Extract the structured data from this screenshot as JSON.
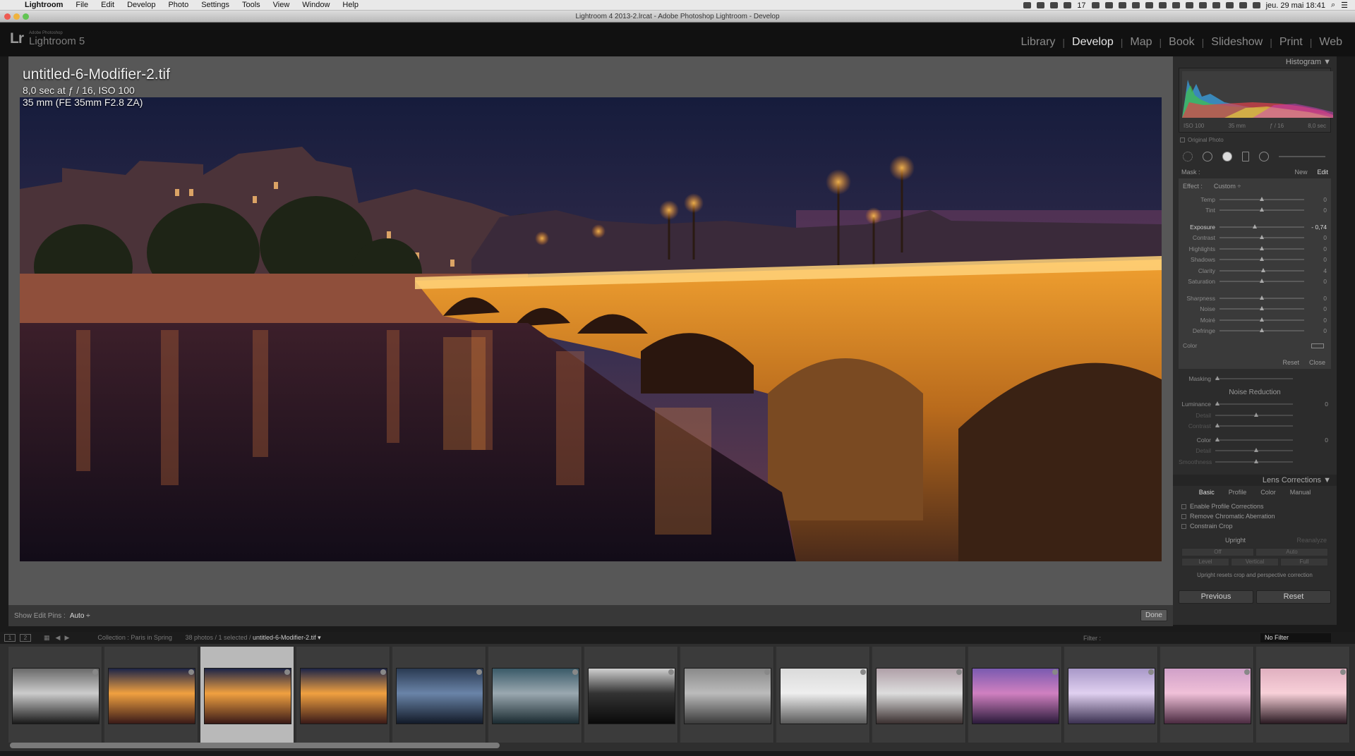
{
  "menubar": {
    "items": [
      "Lightroom",
      "File",
      "Edit",
      "Develop",
      "Photo",
      "Settings",
      "Tools",
      "View",
      "Window",
      "Help"
    ],
    "status_badge": "17",
    "clock": "jeu. 29 mai  18:41"
  },
  "window": {
    "title": "Lightroom 4 2013-2.lrcat - Adobe Photoshop Lightroom - Develop"
  },
  "identity": {
    "logo": "Lr",
    "small": "Adobe Photoshop",
    "name": "Lightroom 5"
  },
  "modules": [
    "Library",
    "Develop",
    "Map",
    "Book",
    "Slideshow",
    "Print",
    "Web"
  ],
  "active_module": "Develop",
  "photo_info": {
    "filename": "untitled-6-Modifier-2.tif",
    "exposure": "8,0 sec at ƒ / 16, ISO 100",
    "lens": "35 mm (FE 35mm F2.8 ZA)"
  },
  "view_toolbar": {
    "pins_label": "Show Edit Pins :",
    "pins_value": "Auto ÷",
    "done": "Done"
  },
  "histogram": {
    "title": "Histogram ▼",
    "iso": "ISO 100",
    "focal": "35 mm",
    "aperture": "ƒ / 16",
    "shutter": "8,0 sec",
    "original_photo": "Original Photo"
  },
  "mask": {
    "label": "Mask :",
    "new": "New",
    "edit": "Edit"
  },
  "brush": {
    "effect_label": "Effect :",
    "effect_value": "Custom ÷",
    "sliders": [
      {
        "label": "Temp",
        "value": "0",
        "pos": 0.5
      },
      {
        "label": "Tint",
        "value": "0",
        "pos": 0.5
      },
      {
        "label": "Exposure",
        "value": "- 0,74",
        "pos": 0.42,
        "highlight": true
      },
      {
        "label": "Contrast",
        "value": "0",
        "pos": 0.5
      },
      {
        "label": "Highlights",
        "value": "0",
        "pos": 0.5
      },
      {
        "label": "Shadows",
        "value": "0",
        "pos": 0.5
      },
      {
        "label": "Clarity",
        "value": "4",
        "pos": 0.52
      },
      {
        "label": "Saturation",
        "value": "0",
        "pos": 0.5
      },
      {
        "label": "Sharpness",
        "value": "0",
        "pos": 0.5
      },
      {
        "label": "Noise",
        "value": "0",
        "pos": 0.5
      },
      {
        "label": "Moiré",
        "value": "0",
        "pos": 0.5
      },
      {
        "label": "Defringe",
        "value": "0",
        "pos": 0.5
      }
    ],
    "color_label": "Color",
    "reset": "Reset",
    "close": "Close"
  },
  "detail": {
    "masking_label": "Masking",
    "noise_reduction": "Noise Reduction",
    "sliders": [
      {
        "label": "Luminance",
        "value": "0",
        "pos": 0.0
      },
      {
        "label": "Detail",
        "value": "",
        "pos": 0.5,
        "dim": true
      },
      {
        "label": "Contrast",
        "value": "",
        "pos": 0.0,
        "dim": true
      },
      {
        "label": "Color",
        "value": "0",
        "pos": 0.0
      },
      {
        "label": "Detail",
        "value": "",
        "pos": 0.5,
        "dim": true
      },
      {
        "label": "Smoothness",
        "value": "",
        "pos": 0.5,
        "dim": true
      }
    ]
  },
  "lens": {
    "title": "Lens Corrections ▼",
    "tabs": [
      "Basic",
      "Profile",
      "Color",
      "Manual"
    ],
    "checkboxes": [
      "Enable Profile Corrections",
      "Remove Chromatic Aberration",
      "Constrain Crop"
    ],
    "upright": "Upright",
    "reanalyze": "Reanalyze",
    "buttons_row1": [
      "Off",
      "Auto"
    ],
    "buttons_row2": [
      "Level",
      "Vertical",
      "Full"
    ],
    "note": "Upright resets crop and perspective correction"
  },
  "footer_buttons": {
    "previous": "Previous",
    "reset": "Reset"
  },
  "filmstrip_bar": {
    "view1": "1",
    "view2": "2",
    "collection": "Collection : Paris in Spring",
    "count": "38 photos / 1 selected /",
    "current": "untitled-6-Modifier-2.tif ▾",
    "filter_label": "Filter :",
    "filter_value": "No Filter"
  },
  "colors": {
    "accent": "#e6e6e6",
    "panel": "#2c2c2c",
    "view_bg": "#575757"
  },
  "thumbnails": [
    {
      "name": "bridge-bw",
      "scheme": "bw"
    },
    {
      "name": "bridge-night-1",
      "scheme": "warm"
    },
    {
      "name": "bridge-night-selected",
      "scheme": "warm",
      "selected": true
    },
    {
      "name": "bridge-night-2",
      "scheme": "warm"
    },
    {
      "name": "seine-blue",
      "scheme": "blue"
    },
    {
      "name": "institut-dusk",
      "scheme": "teal"
    },
    {
      "name": "tunnel-arch",
      "scheme": "dark"
    },
    {
      "name": "notre-dame-mono",
      "scheme": "gray"
    },
    {
      "name": "notre-dame-day",
      "scheme": "light"
    },
    {
      "name": "notre-dame-cloud",
      "scheme": "cloud"
    },
    {
      "name": "notre-dame-purple",
      "scheme": "purple"
    },
    {
      "name": "lamp-dusk",
      "scheme": "lilac"
    },
    {
      "name": "bridge-pink",
      "scheme": "pink"
    },
    {
      "name": "silhouette",
      "scheme": "rose"
    }
  ]
}
